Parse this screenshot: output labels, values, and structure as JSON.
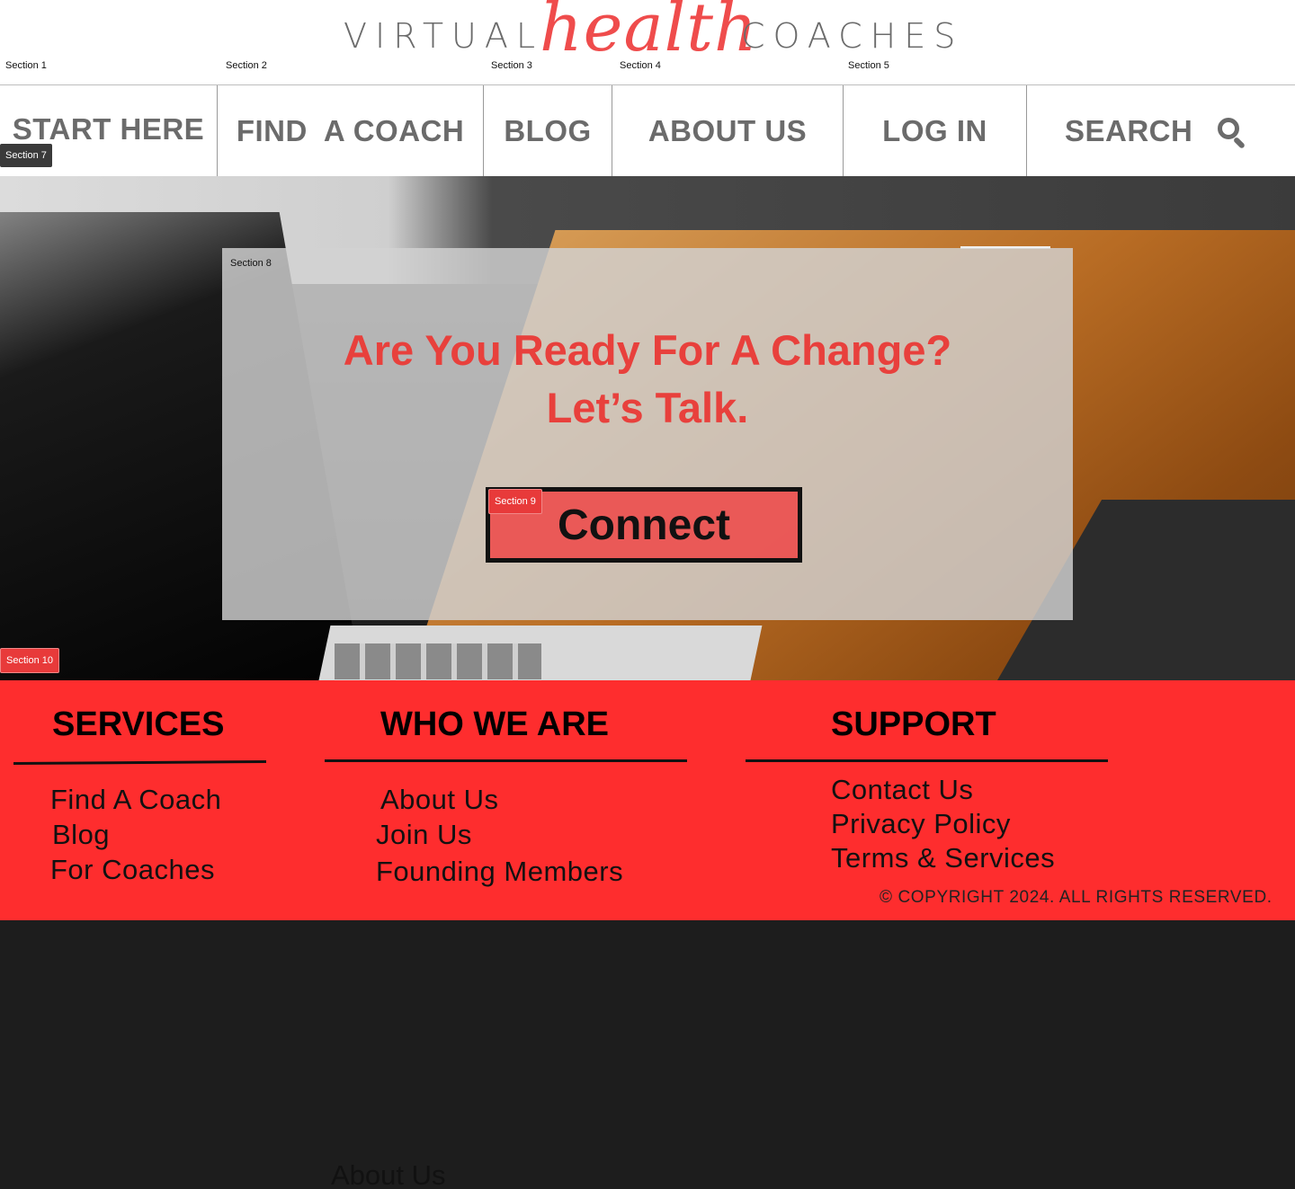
{
  "logo": {
    "left_word": "VIRTUAL",
    "script_word": "health",
    "right_word": "COACHES"
  },
  "section_tags": {
    "s1": "Section 1",
    "s2": "Section 2",
    "s3": "Section 3",
    "s4": "Section 4",
    "s5": "Section 5",
    "s7": "Section 7",
    "s8": "Section 8",
    "s9": "Section 9",
    "s10": "Section 10"
  },
  "nav": {
    "start_here": "START HERE",
    "find_coach": "FIND  A COACH",
    "blog": "BLOG",
    "about_us": "ABOUT US",
    "log_in": "LOG IN",
    "search": "SEARCH"
  },
  "hero": {
    "headline_line1": "Are You Ready For A Change?",
    "headline_line2": "Let’s Talk.",
    "cta_label": "Connect"
  },
  "footer": {
    "services": {
      "heading": "SERVICES",
      "links": [
        "Find A Coach",
        "Blog",
        "For Coaches"
      ]
    },
    "who_we_are": {
      "heading": "WHO WE ARE",
      "links": [
        "About Us",
        "Join Us",
        "Founding Members"
      ]
    },
    "support": {
      "heading": "SUPPORT",
      "links": [
        "Contact Us",
        "Privacy Policy",
        "Terms & Services"
      ]
    },
    "copyright": "© COPYRIGHT 2024. ALL RIGHTS RESERVED."
  },
  "bottom_link": "About Us",
  "colors": {
    "brand_red": "#fe2d2e",
    "headline_red": "#e8403c",
    "nav_gray": "#6b6b6b",
    "page_dark": "#1d1d1d"
  },
  "icons": {
    "search": "search-icon"
  }
}
